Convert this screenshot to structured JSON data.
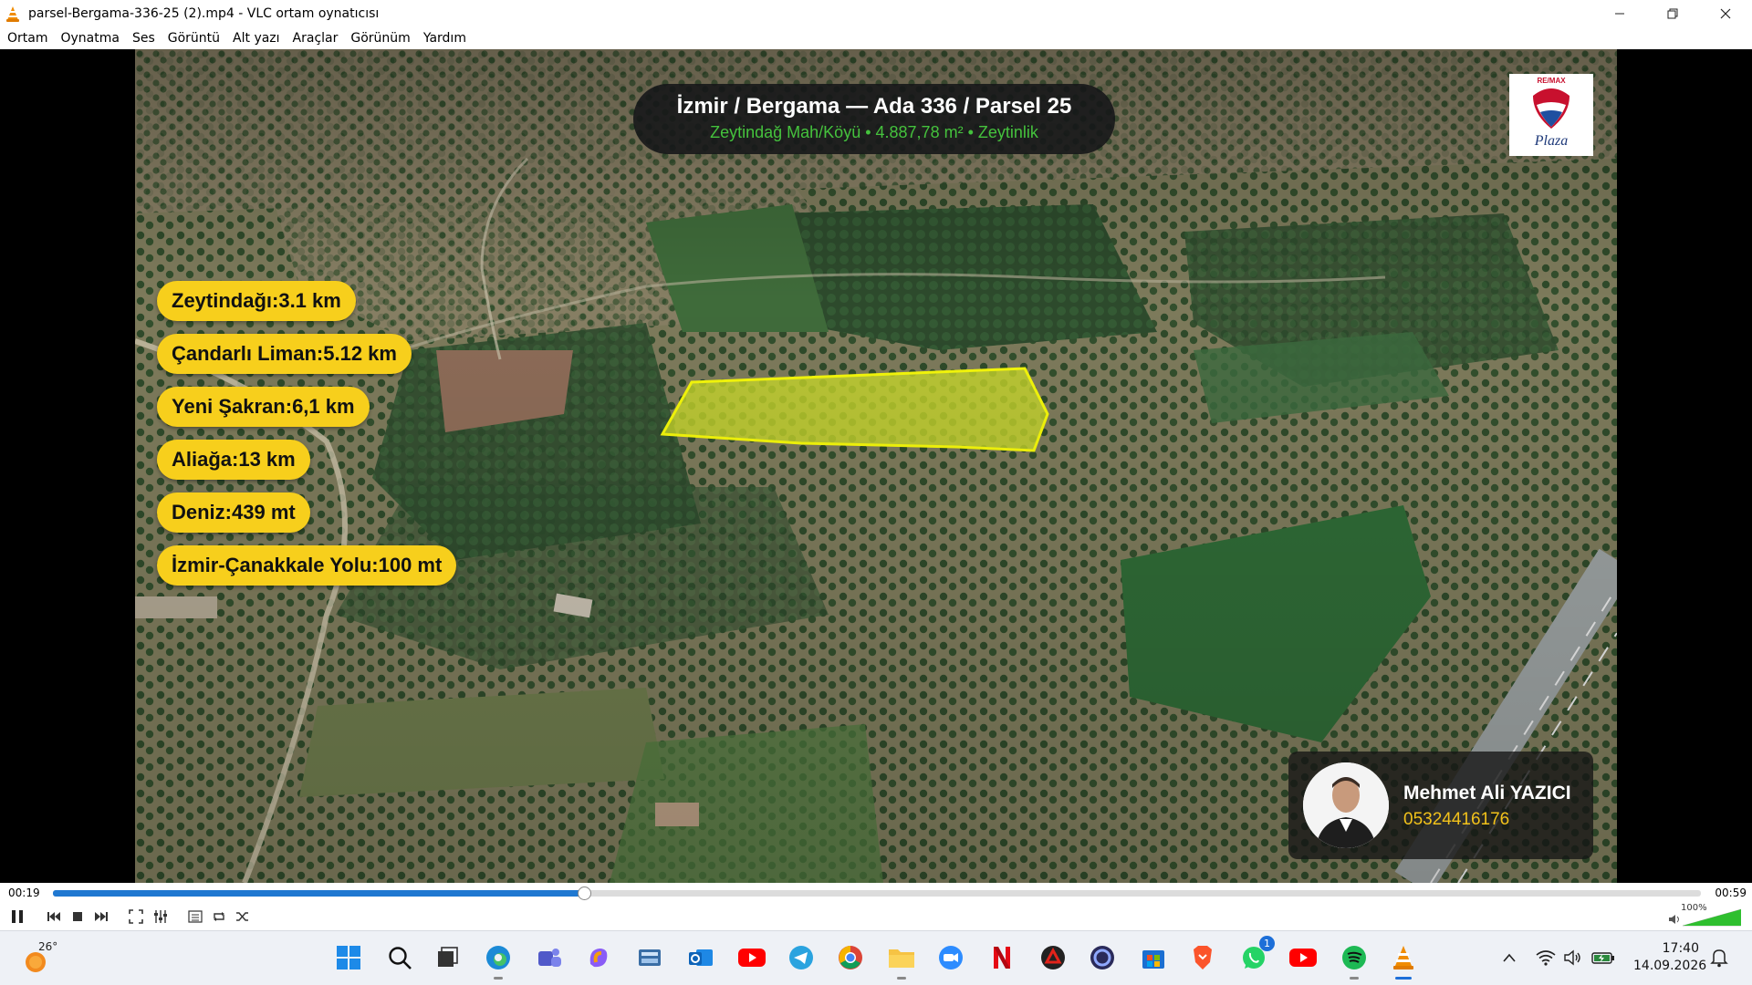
{
  "window": {
    "title": "parsel-Bergama-336-25 (2).mp4 - VLC ortam oynatıcısı",
    "minimize_glyph": "—",
    "close_glyph": "✕"
  },
  "menu": [
    "Ortam",
    "Oynatma",
    "Ses",
    "Görüntü",
    "Alt yazı",
    "Araçlar",
    "Görünüm",
    "Yardım"
  ],
  "video": {
    "header_title": "İzmir / Bergama  —  Ada 336 / Parsel 25",
    "header_subtitle": "Zeytindağ Mah/Köyü  •  4.887,78 m²  •  Zeytinlik",
    "distance_labels": [
      "Zeytindağı:3.1 km",
      "Çandarlı Liman:5.12 km",
      "Yeni Şakran:6,1 km",
      "Aliağa:13 km",
      "Deniz:439 mt",
      "İzmir-Çanakkale Yolu:100 mt"
    ],
    "logo": {
      "brand": "RE/MAX",
      "script": "Plaza"
    },
    "agent": {
      "name": "Mehmet Ali YAZICI",
      "phone": "05324416176"
    },
    "colors": {
      "parcel_fill": "#c9d82a",
      "parcel_stroke": "#f4f70a",
      "label_bg": "#f7cf1c",
      "subtitle_green": "#45c23d"
    }
  },
  "player": {
    "elapsed": "00:19",
    "duration": "00:59",
    "progress_fraction": 0.322,
    "volume_label": "100%",
    "volume_fraction": 1.0,
    "controls": [
      "pause-icon",
      "prev-icon",
      "stop-icon",
      "next-icon",
      "fullscreen-icon",
      "extended-settings-icon",
      "playlist-icon",
      "loop-icon",
      "shuffle-icon"
    ]
  },
  "taskbar": {
    "weather_temp": "26°",
    "whatsapp_badge": "1",
    "time": "17:40",
    "date": "14.09.2026",
    "apps": [
      "start",
      "search",
      "task-view",
      "edge",
      "teams",
      "copilot",
      "files-tool",
      "outlook",
      "youtube",
      "telegram",
      "chrome",
      "file-explorer",
      "zoom",
      "netflix",
      "game",
      "vpn",
      "store",
      "brave",
      "whatsapp",
      "youtube-2",
      "spotify",
      "vlc"
    ]
  }
}
